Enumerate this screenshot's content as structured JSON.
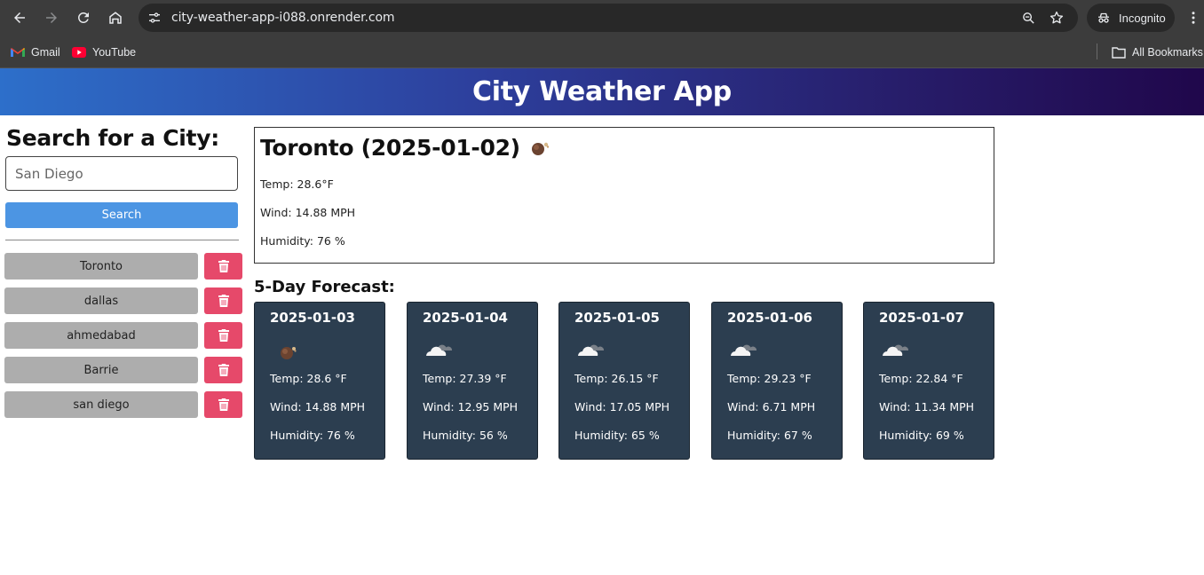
{
  "browser": {
    "url": "city-weather-app-i088.onrender.com",
    "incognito_label": "Incognito",
    "bookmarks": [
      {
        "label": "Gmail",
        "icon": "gmail-icon"
      },
      {
        "label": "YouTube",
        "icon": "youtube-icon"
      }
    ],
    "all_bookmarks_label": "All Bookmarks"
  },
  "app": {
    "title": "City Weather App"
  },
  "search": {
    "heading": "Search for a City:",
    "placeholder": "San Diego",
    "value": "",
    "button_label": "Search"
  },
  "history": [
    {
      "city": "Toronto"
    },
    {
      "city": "dallas"
    },
    {
      "city": "ahmedabad"
    },
    {
      "city": "Barrie"
    },
    {
      "city": "san diego"
    }
  ],
  "current": {
    "heading": "Toronto (2025-01-02)",
    "icon": "night-clear-icon",
    "temp": "Temp: 28.6°F",
    "wind": "Wind: 14.88 MPH",
    "humidity": "Humidity: 76 %"
  },
  "forecast_title": "5-Day Forecast:",
  "forecast": [
    {
      "date": "2025-01-03",
      "icon": "night-clear-icon",
      "temp": "Temp: 28.6 °F",
      "wind": "Wind: 14.88 MPH",
      "humidity": "Humidity: 76 %"
    },
    {
      "date": "2025-01-04",
      "icon": "cloudy-icon",
      "temp": "Temp: 27.39 °F",
      "wind": "Wind: 12.95 MPH",
      "humidity": "Humidity: 56 %"
    },
    {
      "date": "2025-01-05",
      "icon": "cloudy-icon",
      "temp": "Temp: 26.15 °F",
      "wind": "Wind: 17.05 MPH",
      "humidity": "Humidity: 65 %"
    },
    {
      "date": "2025-01-06",
      "icon": "cloudy-icon",
      "temp": "Temp: 29.23 °F",
      "wind": "Wind: 6.71 MPH",
      "humidity": "Humidity: 67 %"
    },
    {
      "date": "2025-01-07",
      "icon": "cloudy-icon",
      "temp": "Temp: 22.84 °F",
      "wind": "Wind: 11.34 MPH",
      "humidity": "Humidity: 69 %"
    }
  ],
  "colors": {
    "search_button": "#4c95e3",
    "delete_button": "#e6496a",
    "city_button": "#adadad",
    "forecast_card": "#2c3e50"
  }
}
